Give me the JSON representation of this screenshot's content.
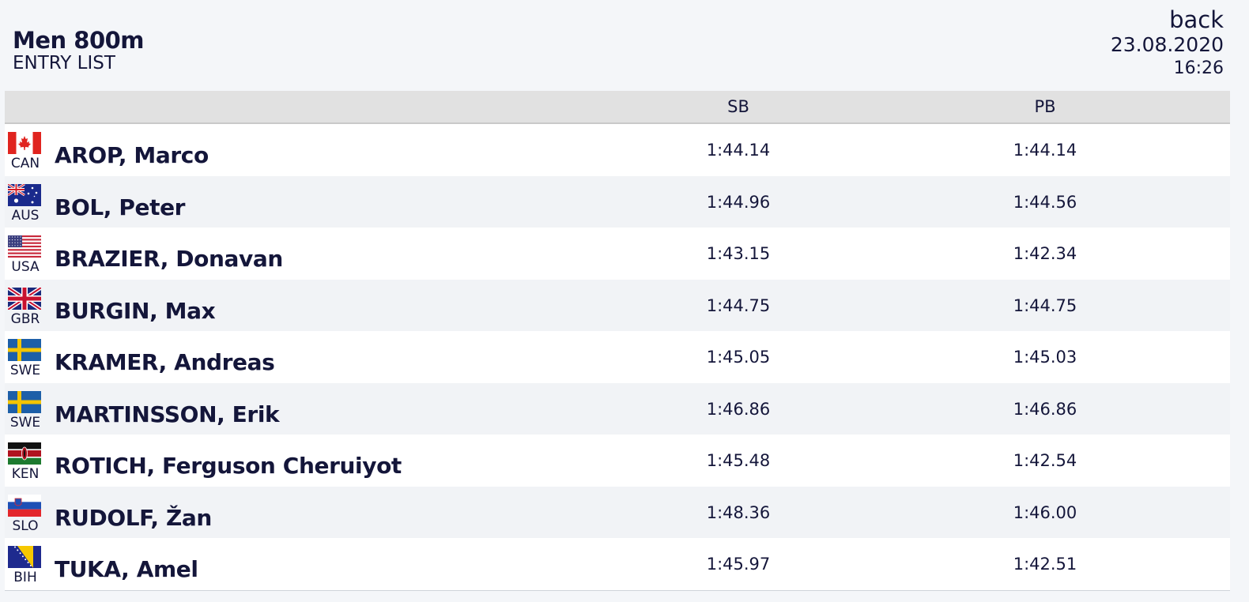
{
  "header": {
    "title": "Men 800m",
    "subtitle": "ENTRY LIST",
    "back_label": "back",
    "date": "23.08.2020",
    "time": "16:26"
  },
  "table": {
    "columns": [
      "SB",
      "PB"
    ],
    "rows": [
      {
        "country": "CAN",
        "flag": "canada-flag-icon",
        "name": "AROP, Marco",
        "sb": "1:44.14",
        "pb": "1:44.14"
      },
      {
        "country": "AUS",
        "flag": "australia-flag-icon",
        "name": "BOL, Peter",
        "sb": "1:44.96",
        "pb": "1:44.56"
      },
      {
        "country": "USA",
        "flag": "usa-flag-icon",
        "name": "BRAZIER, Donavan",
        "sb": "1:43.15",
        "pb": "1:42.34"
      },
      {
        "country": "GBR",
        "flag": "uk-flag-icon",
        "name": "BURGIN, Max",
        "sb": "1:44.75",
        "pb": "1:44.75"
      },
      {
        "country": "SWE",
        "flag": "sweden-flag-icon",
        "name": "KRAMER, Andreas",
        "sb": "1:45.05",
        "pb": "1:45.03"
      },
      {
        "country": "SWE",
        "flag": "sweden-flag-icon",
        "name": "MARTINSSON, Erik",
        "sb": "1:46.86",
        "pb": "1:46.86"
      },
      {
        "country": "KEN",
        "flag": "kenya-flag-icon",
        "name": "ROTICH, Ferguson Cheruiyot",
        "sb": "1:45.48",
        "pb": "1:42.54"
      },
      {
        "country": "SLO",
        "flag": "slovenia-flag-icon",
        "name": "RUDOLF, Žan",
        "sb": "1:48.36",
        "pb": "1:46.00"
      },
      {
        "country": "BIH",
        "flag": "bosnia-flag-icon",
        "name": "TUKA, Amel",
        "sb": "1:45.97",
        "pb": "1:42.51"
      }
    ]
  },
  "colors": {
    "text": "#14163a",
    "header_bg": "#e1e1e1",
    "row_alt_bg": "#f1f3f6",
    "row_bg": "#ffffff",
    "page_bg": "#f4f6f9"
  }
}
